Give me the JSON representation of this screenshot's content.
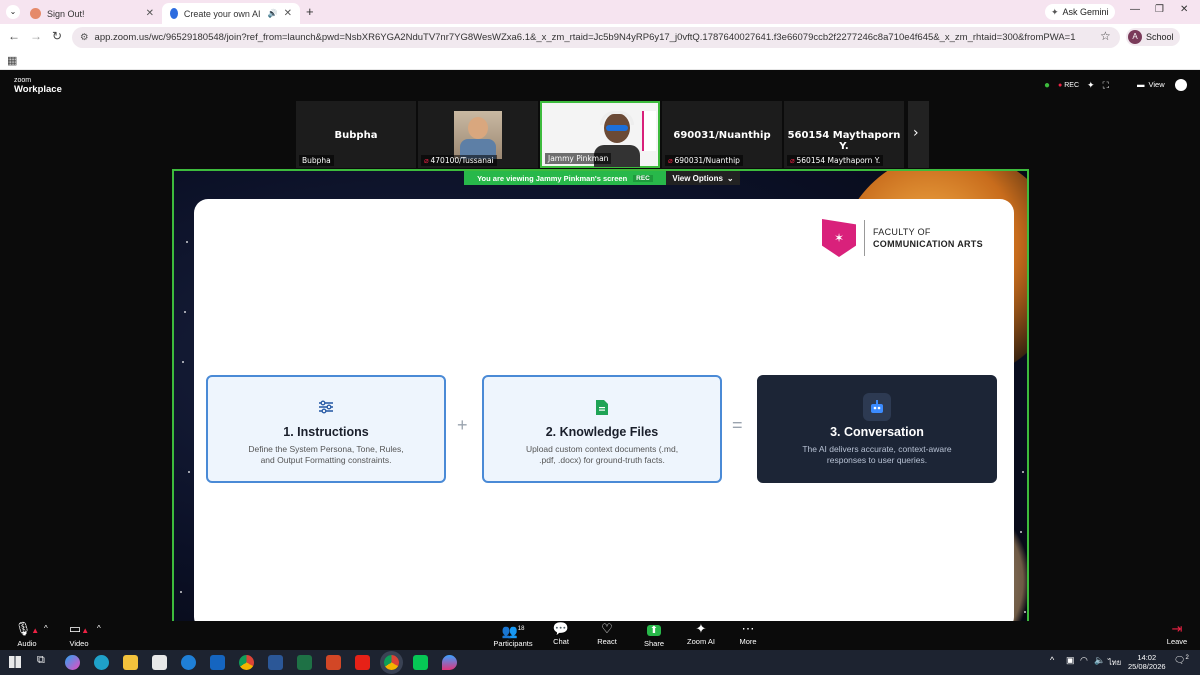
{
  "browser": {
    "tabs": [
      {
        "title": "Sign Out!",
        "active": false
      },
      {
        "title": "Create your own AI Chatbo",
        "active": true
      }
    ],
    "ask_gemini": "Ask Gemini",
    "url": "app.zoom.us/wc/96529180548/join?ref_from=launch&pwd=NsbXR6YGA2NduTV7nr7YG8WesWZxa6.1&_x_zm_rtaid=Jc5b9N4yRP6y17_j0vftQ.1787640027641.f3e66079ccb2f2277246c8a710e4f645&_x_zm_rhtaid=300&fromPWA=1",
    "profile_initial": "A",
    "profile_label": "School"
  },
  "zoom": {
    "brand_small": "zoom",
    "brand": "Workplace",
    "rec_label": "REC",
    "view_label": "View",
    "participants": [
      {
        "display": "Bubpha",
        "name": "Bubpha",
        "muted": false,
        "video": false
      },
      {
        "display": "",
        "name": "470100/Tussanai",
        "muted": true,
        "video": true
      },
      {
        "display": "",
        "name": "Jammy Pinkman",
        "muted": false,
        "video": true
      },
      {
        "display": "690031/Nuanthip",
        "name": "690031/Nuanthip",
        "muted": true,
        "video": false
      },
      {
        "display": "560154 Maythaporn Y.",
        "name": "560154 Maythaporn Y.",
        "muted": true,
        "video": false
      }
    ],
    "banner": {
      "text": "You are viewing  Jammy Pinkman's screen",
      "rec": "REC"
    },
    "view_options": "View Options"
  },
  "slide": {
    "logo_line1": "FACULTY OF",
    "logo_line2": "COMMUNICATION ARTS",
    "cards": [
      {
        "title": "1. Instructions",
        "desc": "Define the System Persona, Tone, Rules, and Output Formatting constraints.",
        "icon": "sliders-icon"
      },
      {
        "title": "2. Knowledge Files",
        "desc": "Upload custom context documents (.md, .pdf, .docx) for ground-truth facts.",
        "icon": "document-icon"
      },
      {
        "title": "3. Conversation",
        "desc": "The AI delivers accurate, context-aware responses to user queries.",
        "icon": "robot-icon"
      }
    ],
    "plus": "+",
    "equals": "="
  },
  "controls": {
    "audio": "Audio",
    "video": "Video",
    "participants": "Participants",
    "participants_count": "18",
    "chat": "Chat",
    "react": "React",
    "share": "Share",
    "zoom_ai": "Zoom AI",
    "more": "More",
    "leave": "Leave"
  },
  "taskbar": {
    "language": "ไทย",
    "time": "14:02",
    "date": "25/08/2026",
    "notifications": "2"
  },
  "colors": {
    "share_border": "#3dbb3d",
    "card_border": "#4a8ad6",
    "dark_card": "#1c2536",
    "logo_magenta": "#d9217b"
  }
}
